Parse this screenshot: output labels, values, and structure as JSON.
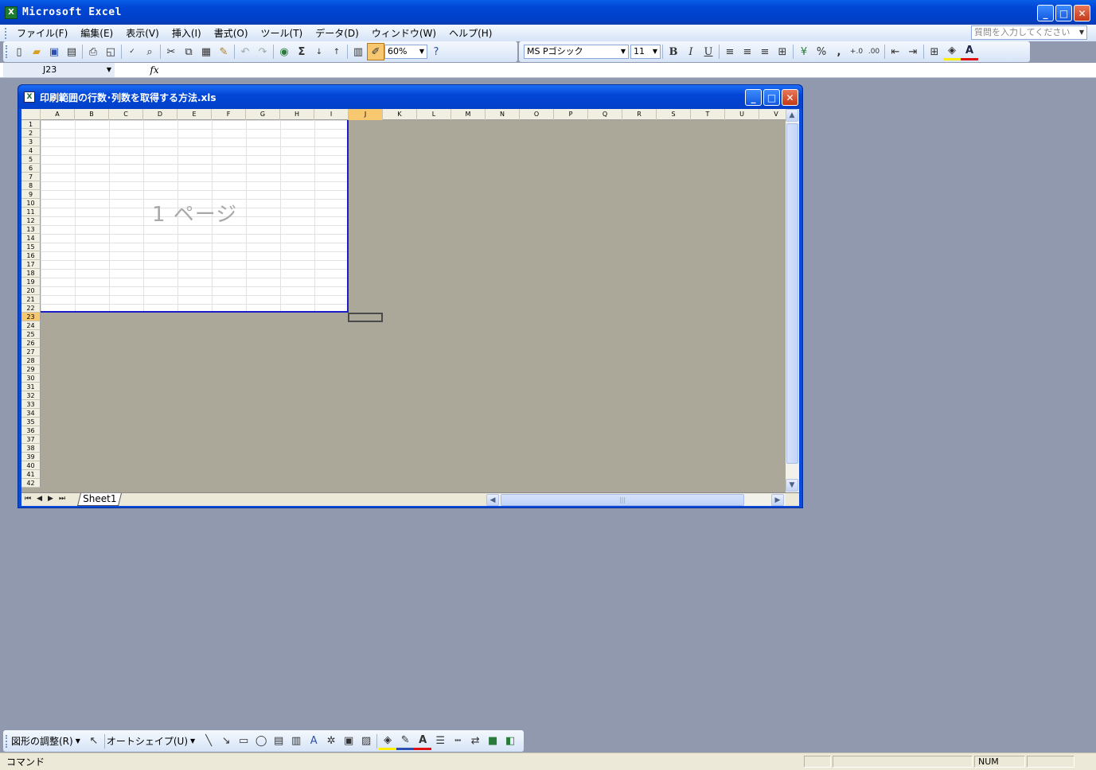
{
  "app": {
    "title": "Microsoft Excel"
  },
  "menu": [
    "ファイル(F)",
    "編集(E)",
    "表示(V)",
    "挿入(I)",
    "書式(O)",
    "ツール(T)",
    "データ(D)",
    "ウィンドウ(W)",
    "ヘルプ(H)"
  ],
  "ask_placeholder": "質問を入力してください",
  "standard_toolbar": {
    "zoom": "60%"
  },
  "format_toolbar": {
    "font": "MS Pゴシック",
    "size": "11",
    "bold": "B",
    "italic": "I",
    "underline": "U",
    "percent": "%",
    "comma": ","
  },
  "formula_bar": {
    "name_box": "J23",
    "fx": "fx"
  },
  "workbook": {
    "title": "印刷範囲の行数･列数を取得する方法.xls",
    "page_label": "1 ページ",
    "sheet_tab": "Sheet1"
  },
  "columns": [
    "A",
    "B",
    "C",
    "D",
    "E",
    "F",
    "G",
    "H",
    "I",
    "J",
    "K",
    "L",
    "M",
    "N",
    "O",
    "P",
    "Q",
    "R",
    "S",
    "T",
    "U",
    "V"
  ],
  "rows": [
    "1",
    "2",
    "3",
    "4",
    "5",
    "6",
    "7",
    "8",
    "9",
    "10",
    "11",
    "12",
    "13",
    "14",
    "15",
    "16",
    "17",
    "18",
    "19",
    "20",
    "21",
    "22",
    "23",
    "24",
    "25",
    "26",
    "27",
    "28",
    "29",
    "30",
    "31",
    "32",
    "33",
    "34",
    "35",
    "36",
    "37",
    "38",
    "39",
    "40",
    "41",
    "42"
  ],
  "selected": {
    "column": "J",
    "row": "23"
  },
  "drawing_toolbar": {
    "draw_menu": "図形の調整(R)",
    "autoshapes": "オートシェイプ(U)"
  },
  "status": {
    "text": "コマンド",
    "num": "NUM"
  },
  "colors": {
    "accent": "#0a4ad8",
    "page_border": "#1a1ec8",
    "selected_header": "#f8c870"
  }
}
